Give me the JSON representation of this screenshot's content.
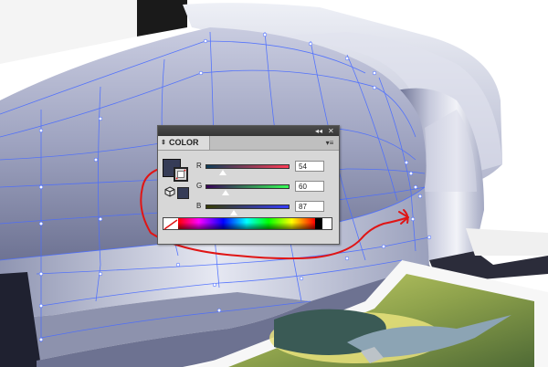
{
  "colors": {
    "fill": "#363c57",
    "printer_body": "#9aa0bc",
    "mesh_line": "#4a6cff",
    "annotation": "#e01515"
  },
  "color_panel": {
    "title": "COLOR",
    "tab_arrows_icon": "double-arrow-icon",
    "menu_icon": "panel-menu-icon",
    "collapse_icon": "collapse-icon",
    "close_icon": "close-icon",
    "channels": [
      {
        "label": "R",
        "value": "54",
        "level": 0.21
      },
      {
        "label": "G",
        "value": "60",
        "level": 0.24
      },
      {
        "label": "B",
        "value": "87",
        "level": 0.34
      }
    ]
  }
}
